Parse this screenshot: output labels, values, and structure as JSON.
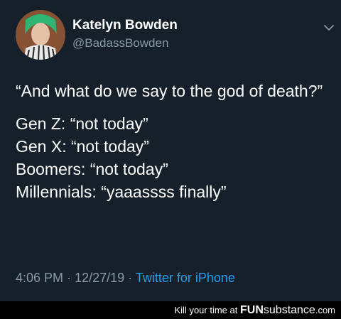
{
  "tweet": {
    "author": {
      "display_name": "Katelyn Bowden",
      "handle": "@BadassBowden"
    },
    "lines": [
      "“And what do we say to the god of death?”",
      "Gen Z: “not today”",
      "Gen X: “not today”",
      "Boomers: “not today”",
      "Millennials: “yaaassss finally”"
    ],
    "time": "4:06 PM",
    "sep1": "·",
    "date": "12/27/19",
    "sep2": "·",
    "source": "Twitter for iPhone"
  },
  "footer": {
    "tagline": "Kill your time at",
    "brand_part1": "FUN",
    "brand_part2": "substance",
    "brand_part3": ".com"
  },
  "colors": {
    "background": "#15202b",
    "secondary_text": "#8899a6",
    "link": "#1da1f2",
    "footer_background": "#000000"
  },
  "icons": {
    "menu": "chevron-down-icon"
  }
}
